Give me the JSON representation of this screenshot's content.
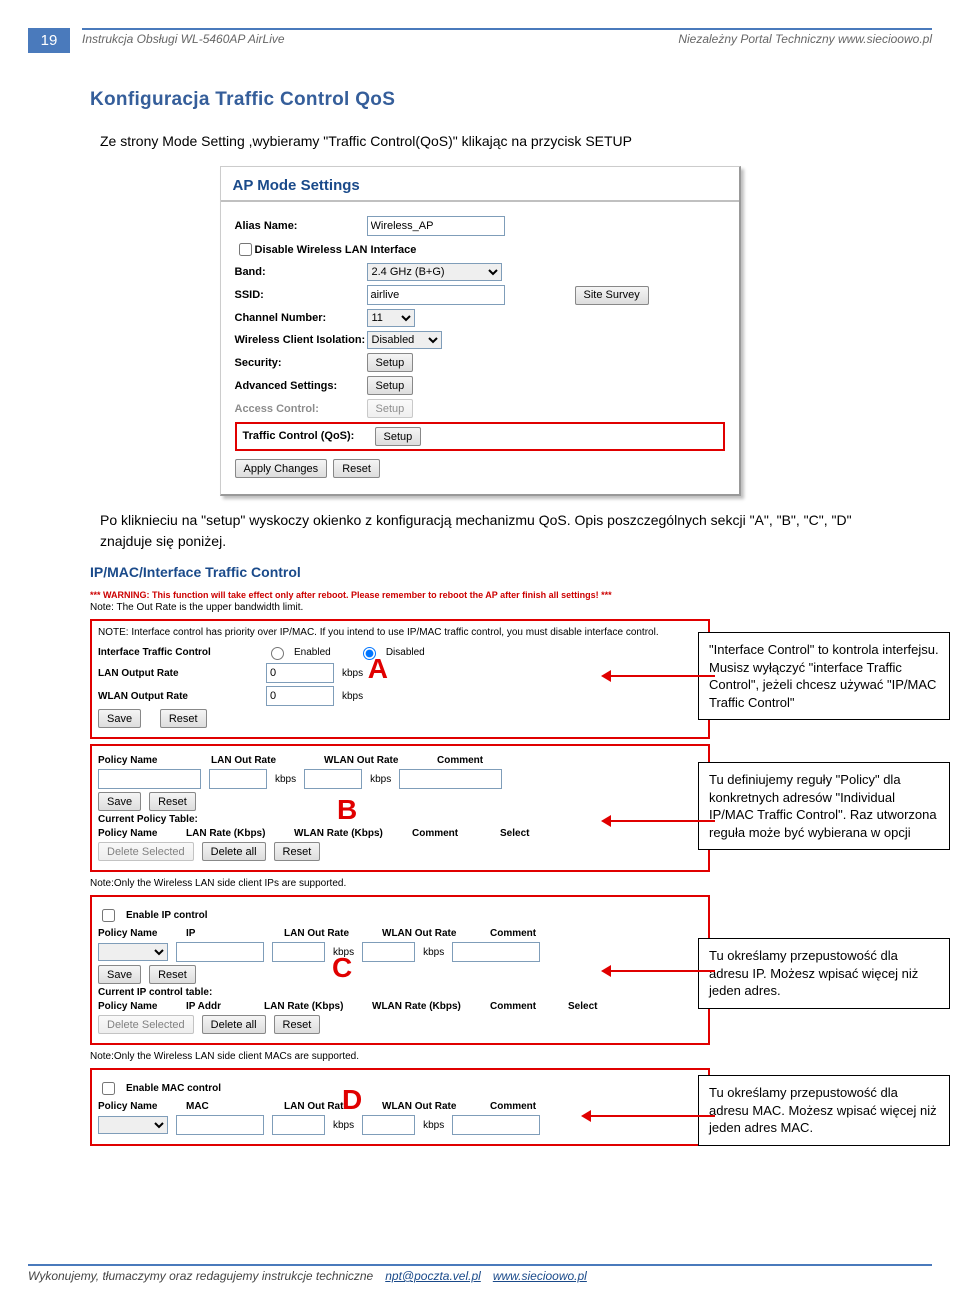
{
  "header": {
    "pagenum": "19",
    "left": "Instrukcja Obsługi WL-5460AP  AirLive",
    "right": "Niezależny Portal Techniczny www.siecioowo.pl"
  },
  "h2": "Konfiguracja Traffic Control QoS",
  "intro": "Ze strony Mode Setting ,wybieramy \"Traffic Control(QoS)\" klikając na przycisk SETUP",
  "ap": {
    "title": "AP Mode Settings",
    "alias_lbl": "Alias Name:",
    "alias_val": "Wireless_AP",
    "disable_lbl": "Disable Wireless LAN Interface",
    "band_lbl": "Band:",
    "band_val": "2.4 GHz (B+G)",
    "ssid_lbl": "SSID:",
    "ssid_val": "airlive",
    "survey": "Site Survey",
    "chn_lbl": "Channel Number:",
    "chn_val": "11",
    "iso_lbl": "Wireless Client Isolation:",
    "iso_val": "Disabled",
    "sec_lbl": "Security:",
    "setup": "Setup",
    "adv_lbl": "Advanced Settings:",
    "acc_lbl": "Access Control:",
    "tc_lbl": "Traffic Control (QoS):",
    "apply": "Apply Changes",
    "reset": "Reset"
  },
  "after": "Po kliknieciu na \"setup\" wyskoczy okienko z konfiguracją mechanizmu QoS. Opis poszczególnych sekcji \"A\", \"B\", \"C\", \"D\" znajduje się poniżej.",
  "tc": {
    "title": "IP/MAC/Interface Traffic Control",
    "warn": "*** WARNING: This function will take effect only after reboot. Please remember to reboot the AP after finish all settings! ***",
    "note1": "Note: The Out Rate is the upper bandwidth limit.",
    "noteA": "NOTE: Interface control has priority over IP/MAC. If you intend to use IP/MAC traffic control, you must disable interface control.",
    "itc": "Interface Traffic Control",
    "enabled": "Enabled",
    "disabled": "Disabled",
    "lor": "LAN Output Rate",
    "wor": "WLAN Output Rate",
    "kbps": "kbps",
    "zero": "0",
    "save": "Save",
    "resetb": "Reset",
    "pn": "Policy Name",
    "lorh": "LAN Out Rate",
    "worh": "WLAN Out Rate",
    "cmt": "Comment",
    "cpt": "Current Policy Table:",
    "lrk": "LAN Rate (Kbps)",
    "wrk": "WLAN Rate (Kbps)",
    "sel": "Select",
    "ds": "Delete Selected",
    "da": "Delete all",
    "noteC": "Note:Only the Wireless LAN side client IPs are supported.",
    "eip": "Enable IP control",
    "ip": "IP",
    "cip": "Current IP control table:",
    "ipa": "IP Addr",
    "noteD": "Note:Only the Wireless LAN side client MACs are supported.",
    "emac": "Enable MAC control",
    "mac": "MAC"
  },
  "letters": {
    "A": "A",
    "B": "B",
    "C": "C",
    "D": "D"
  },
  "ann": {
    "A": "\"Interface Control\" to kontrola interfejsu. Musisz wyłączyć \"interface Traffic Control\", jeżeli chcesz używać \"IP/MAC Traffic Control\"",
    "B": "Tu definiujemy reguły \"Policy\" dla konkretnych adresów \"Individual IP/MAC Traffic Control\". Raz utworzona reguła może być wybierana w opcji",
    "C": "Tu określamy przepustowość dla adresu IP. Możesz wpisać więcej niż jeden adres.",
    "D": "Tu określamy przepustowość dla adresu MAC. Możesz wpisać więcej niż jeden adres MAC."
  },
  "footer": {
    "text": "Wykonujemy, tłumaczymy oraz redagujemy instrukcje techniczne",
    "email": "npt@poczta.vel.pl",
    "url": "www.siecioowo.pl"
  }
}
